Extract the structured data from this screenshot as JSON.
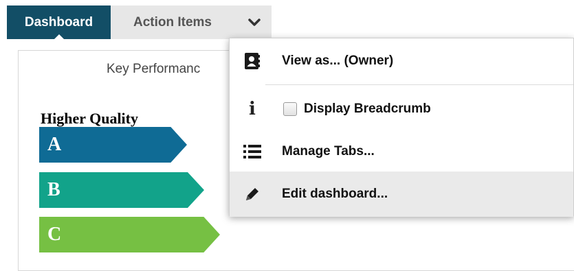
{
  "tabs": {
    "dashboard": "Dashboard",
    "action_items": "Action Items",
    "more_icon": "chevron-down-icon"
  },
  "panel": {
    "title": "Key Performanc",
    "quality_label": "Higher Quality",
    "grades": [
      "A",
      "B",
      "C"
    ]
  },
  "menu": {
    "view_as": "View as... (Owner)",
    "display_breadcrumb": "Display Breadcrumb",
    "display_breadcrumb_checked": false,
    "manage_tabs": "Manage Tabs...",
    "edit_dashboard": "Edit dashboard...",
    "icons": [
      "contact-card-icon",
      "info-icon",
      "list-icon",
      "pencil-icon"
    ]
  },
  "colors": {
    "tab_active": "#124e66",
    "grade_a": "#0f6b95",
    "grade_b": "#12a38a",
    "grade_c": "#76c043"
  }
}
